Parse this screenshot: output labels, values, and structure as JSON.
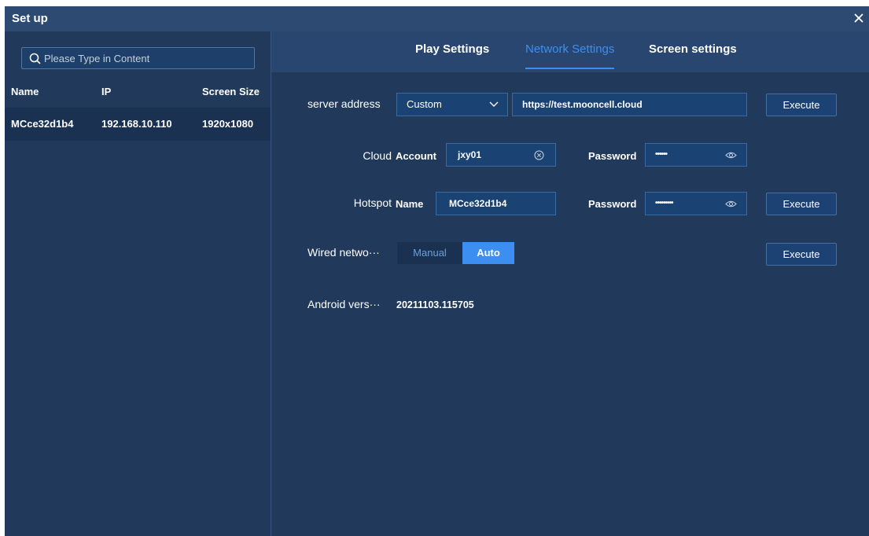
{
  "window": {
    "title": "Set up"
  },
  "sidebar": {
    "search_placeholder": "Please Type in Content",
    "columns": [
      "Name",
      "IP",
      "Screen Size"
    ],
    "rows": [
      {
        "name": "MCce32d1b4",
        "ip": "192.168.10.110",
        "screen_size": "1920x1080"
      }
    ]
  },
  "tabs": [
    {
      "label": "Play Settings",
      "active": false
    },
    {
      "label": "Network Settings",
      "active": true
    },
    {
      "label": "Screen settings",
      "active": false
    }
  ],
  "server": {
    "label": "server address",
    "mode": "Custom",
    "url": "https://test.mooncell.cloud",
    "execute_label": "Execute"
  },
  "cloud": {
    "label": "Cloud",
    "account_label": "Account",
    "account_value": "jxy01",
    "password_label": "Password",
    "password_mask": "••••••"
  },
  "hotspot": {
    "label": "Hotspot",
    "name_label": "Name",
    "name_value": "MCce32d1b4",
    "password_label": "Password",
    "password_mask": "•••••••••",
    "execute_label": "Execute"
  },
  "wired": {
    "label": "Wired netwo···",
    "manual_label": "Manual",
    "auto_label": "Auto",
    "selected": "Auto",
    "execute_label": "Execute"
  },
  "android": {
    "label": "Android vers···",
    "value": "20211103.115705"
  },
  "colors": {
    "accent": "#3c8ff0",
    "panel": "#21395b",
    "field": "#1a4272",
    "tabbar": "#284670"
  }
}
